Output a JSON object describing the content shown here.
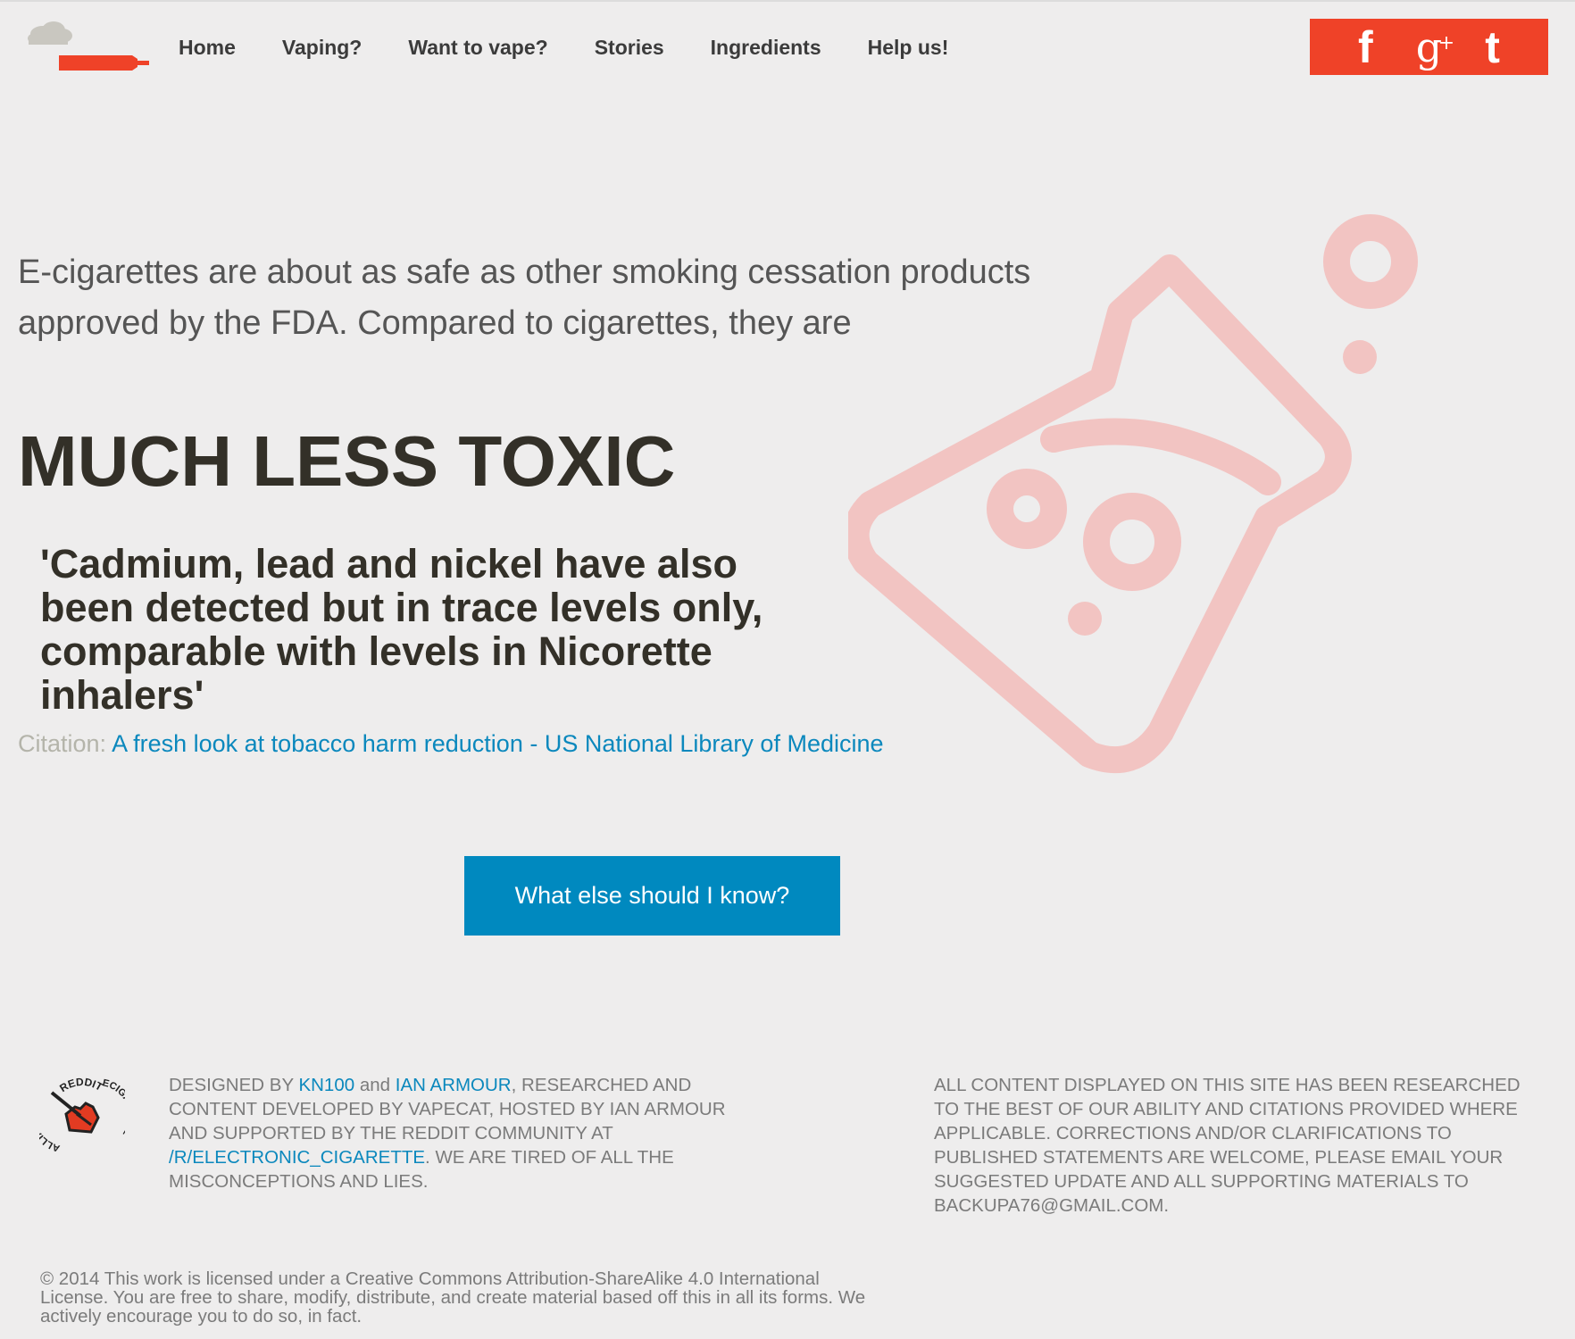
{
  "nav": {
    "items": [
      "Home",
      "Vaping?",
      "Want to vape?",
      "Stories",
      "Ingredients",
      "Help us!"
    ]
  },
  "social": {
    "facebook": "f",
    "googleplus": "g",
    "googleplus_sup": "+",
    "twitter": "t",
    "bg_color": "#ef4228"
  },
  "hero": {
    "intro": "E-cigarettes are about as safe as other smoking cessation products approved by the FDA. Compared to cigarettes, they are",
    "headline": "MUCH LESS TOXIC",
    "quote": "'Cadmium, lead and nickel have also been detected but in trace levels only, comparable with levels in Nicorette inhalers'",
    "citation_label": "Citation:",
    "citation_link": "A fresh look at tobacco harm reduction - US National Library of Medicine",
    "cta_label": "What else should I know?"
  },
  "footer": {
    "designed_by": "DESIGNED BY",
    "kn100": "KN100",
    "and": "and",
    "ian_armour": "IAN ARMOUR",
    "text1": ", RESEARCHED AND CONTENT DEVELOPED BY VAPECAT, HOSTED BY IAN ARMOUR AND SUPPORTED BY THE REDDIT COMMUNITY AT",
    "subreddit": "/R/ELECTRONIC_CIGARETTE",
    "text2": ". WE ARE TIRED OF ALL THE MISCONCEPTIONS AND LIES.",
    "right": "ALL CONTENT DISPLAYED ON THIS SITE HAS BEEN RESEARCHED TO THE BEST OF OUR ABILITY AND CITATIONS PROVIDED WHERE APPLICABLE. CORRECTIONS AND/OR CLARIFICATIONS TO PUBLISHED STATEMENTS ARE WELCOME, PLEASE EMAIL YOUR SUGGESTED UPDATE AND ALL SUPPORTING MATERIALS TO BACKUPA76@GMAIL.COM.",
    "license": "© 2014 This work is licensed under a Creative Commons Attribution-ShareAlike 4.0 International License. You are free to share, modify, distribute, and create material based off this in all its forms. We actively encourage you to do so, in fact.",
    "badge_top": "REDDIT",
    "badge_right": "ECIGARETTE",
    "badge_left": "ALLIANCE"
  },
  "colors": {
    "accent_red": "#ef4228",
    "link_blue": "#0b88bd",
    "button_blue": "#0089bf",
    "flask_pink": "#f2c4c2"
  },
  "icons": [
    "cloud-vape-logo-icon",
    "facebook-icon",
    "googleplus-icon",
    "twitter-icon",
    "flask-icon",
    "reddit-alliance-badge-icon"
  ]
}
